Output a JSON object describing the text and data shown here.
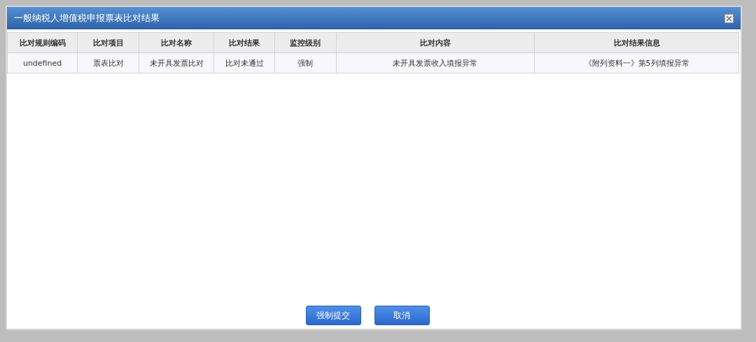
{
  "dialog": {
    "title": "一般纳税人增值税申报票表比对结果"
  },
  "table": {
    "columns": [
      "比对规则编码",
      "比对项目",
      "比对名称",
      "比对结果",
      "监控级别",
      "比对内容",
      "比对结果信息"
    ],
    "rows": [
      [
        "undefined",
        "票表比对",
        "未开具发票比对",
        "比对未通过",
        "强制",
        "未开具发票收入填报异常",
        "《附列资料一》第5列填报异常"
      ]
    ]
  },
  "buttons": [
    "强制提交",
    "取消"
  ]
}
